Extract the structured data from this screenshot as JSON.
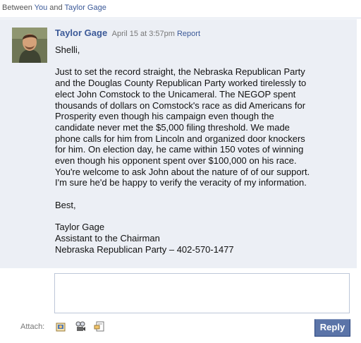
{
  "thread": {
    "between_prefix": "Between",
    "you_label": "You",
    "and_word": "and",
    "other_participant": "Taylor Gage"
  },
  "message": {
    "author": "Taylor Gage",
    "timestamp": "April 15 at 3:57pm",
    "report_label": "Report",
    "greeting": "Shelli,",
    "body_lines": [
      "Just to set the record straight, the Nebraska Republican Party",
      "and the Douglas County Republican Party worked tirelessly to",
      "elect John Comstock to the Unicameral. The NEGOP spent",
      "thousands of dollars on Comstock's race as did Americans for",
      "Prosperity even though his campaign even though the",
      "candidate never met the $5,000 filing threshold. We made",
      "phone calls for him from Lincoln and organized door knockers",
      "for him. On election day, he came within 150 votes of winning",
      "even though his opponent spent over $100,000 on his race.",
      "You're welcome to ask John about the nature of of our support.",
      "I'm sure he'd be happy to verify the veracity of my information."
    ],
    "closing": "Best,",
    "signature": [
      "Taylor Gage",
      "Assistant to the Chairman",
      "Nebraska Republican Party – 402-570-1477"
    ]
  },
  "composer": {
    "reply_value": "",
    "attach_label": "Attach:",
    "attach_icons": [
      "photo-attach-icon",
      "video-attach-icon",
      "link-attach-icon"
    ],
    "reply_button_label": "Reply"
  },
  "colors": {
    "link": "#3b5998",
    "message_background": "#eceff5",
    "button_background": "#5b74a8",
    "border": "#bdc7d8"
  }
}
